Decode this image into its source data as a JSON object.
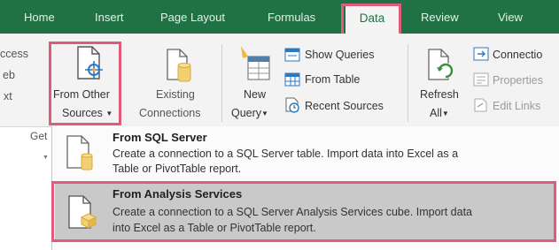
{
  "tabs": [
    "Home",
    "Insert",
    "Page Layout",
    "Formulas",
    "Data",
    "Review",
    "View"
  ],
  "left_partial": [
    "ccess",
    "eb",
    "xt"
  ],
  "from_other": {
    "line1": "From Other",
    "line2": "Sources"
  },
  "existing": {
    "line1": "Existing",
    "line2": "Connections"
  },
  "new_query": {
    "line1": "New",
    "line2": "Query"
  },
  "queries_group": [
    "Show Queries",
    "From Table",
    "Recent Sources"
  ],
  "refresh": {
    "line1": "Refresh",
    "line2": "All"
  },
  "connections_group": [
    "Connectio",
    "Properties",
    "Edit Links"
  ],
  "group_label_partial": "Get",
  "menu": {
    "items": [
      {
        "title": "From SQL Server",
        "desc1": "Create a connection to a SQL Server table. Import data into Excel as a",
        "desc2": "Table or PivotTable report."
      },
      {
        "title": "From Analysis Services",
        "desc1": "Create a connection to a SQL Server Analysis Services cube. Import data",
        "desc2": "into Excel as a Table or PivotTable report."
      }
    ]
  },
  "colors": {
    "ribbon_green": "#207245",
    "highlight": "#e05c7c",
    "selected_row": "#c9c9c9"
  }
}
